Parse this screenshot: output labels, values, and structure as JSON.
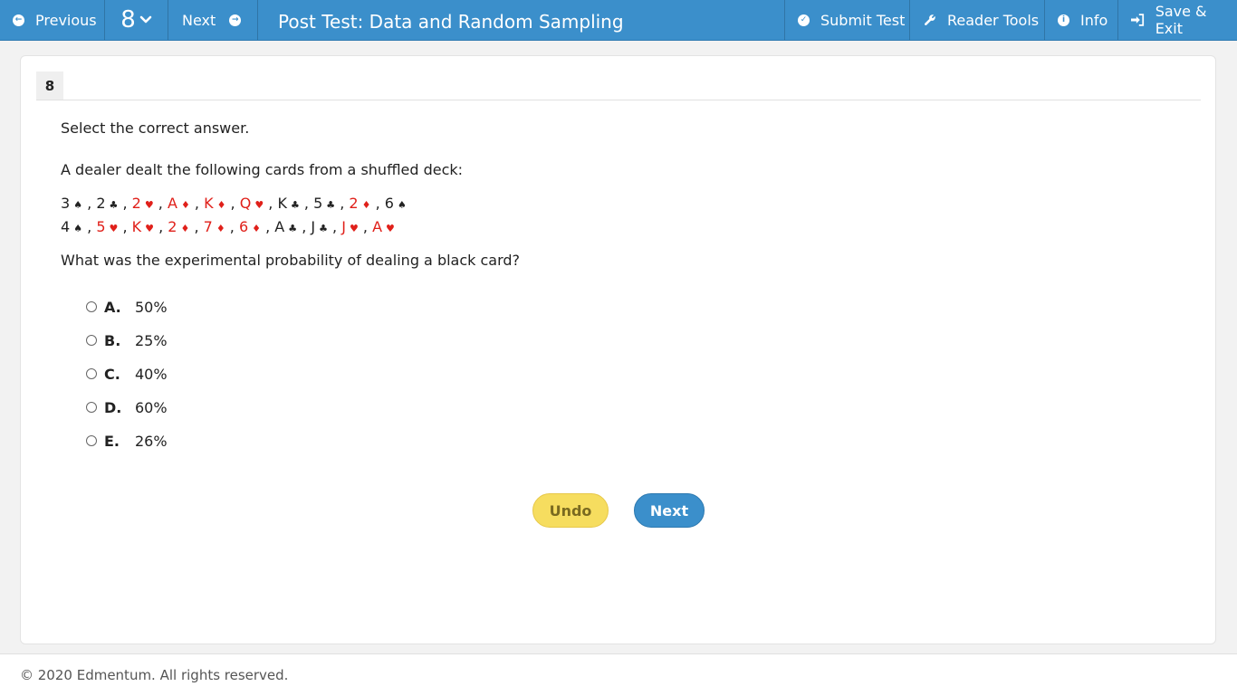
{
  "toolbar": {
    "previous_label": "Previous",
    "question_number": "8",
    "next_label": "Next",
    "title": "Post Test: Data and Random Sampling",
    "submit_label": "Submit Test",
    "reader_tools_label": "Reader Tools",
    "info_label": "Info",
    "save_exit_label": "Save & Exit"
  },
  "question": {
    "number": "8",
    "instruction": "Select the correct answer.",
    "prompt": "A dealer dealt the following cards from a shuffled deck:",
    "cards_row1": [
      {
        "rank": "3",
        "suit": "♠",
        "color": "black"
      },
      {
        "rank": "2",
        "suit": "♣",
        "color": "black"
      },
      {
        "rank": "2",
        "suit": "♥",
        "color": "red"
      },
      {
        "rank": "A",
        "suit": "♦",
        "color": "red"
      },
      {
        "rank": "K",
        "suit": "♦",
        "color": "red"
      },
      {
        "rank": "Q",
        "suit": "♥",
        "color": "red"
      },
      {
        "rank": "K",
        "suit": "♣",
        "color": "black"
      },
      {
        "rank": "5",
        "suit": "♣",
        "color": "black"
      },
      {
        "rank": "2",
        "suit": "♦",
        "color": "red"
      },
      {
        "rank": "6",
        "suit": "♠",
        "color": "black"
      }
    ],
    "cards_row2": [
      {
        "rank": "4",
        "suit": "♠",
        "color": "black"
      },
      {
        "rank": "5",
        "suit": "♥",
        "color": "red"
      },
      {
        "rank": "K",
        "suit": "♥",
        "color": "red"
      },
      {
        "rank": "2",
        "suit": "♦",
        "color": "red"
      },
      {
        "rank": "7",
        "suit": "♦",
        "color": "red"
      },
      {
        "rank": "6",
        "suit": "♦",
        "color": "red"
      },
      {
        "rank": "A",
        "suit": "♣",
        "color": "black"
      },
      {
        "rank": "J",
        "suit": "♣",
        "color": "black"
      },
      {
        "rank": "J",
        "suit": "♥",
        "color": "red"
      },
      {
        "rank": "A",
        "suit": "♥",
        "color": "red"
      }
    ],
    "ask": "What was the experimental probability of dealing a black card?",
    "options": [
      {
        "letter": "A.",
        "text": "50%"
      },
      {
        "letter": "B.",
        "text": "25%"
      },
      {
        "letter": "C.",
        "text": "40%"
      },
      {
        "letter": "D.",
        "text": "60%"
      },
      {
        "letter": "E.",
        "text": "26%"
      }
    ]
  },
  "actions": {
    "undo_label": "Undo",
    "next_label": "Next"
  },
  "footer": {
    "copyright": "© 2020 Edmentum. All rights reserved."
  },
  "colors": {
    "toolbar_blue": "#3b8fcb",
    "red_card": "#e0201a",
    "undo_yellow": "#f6dd5f"
  }
}
